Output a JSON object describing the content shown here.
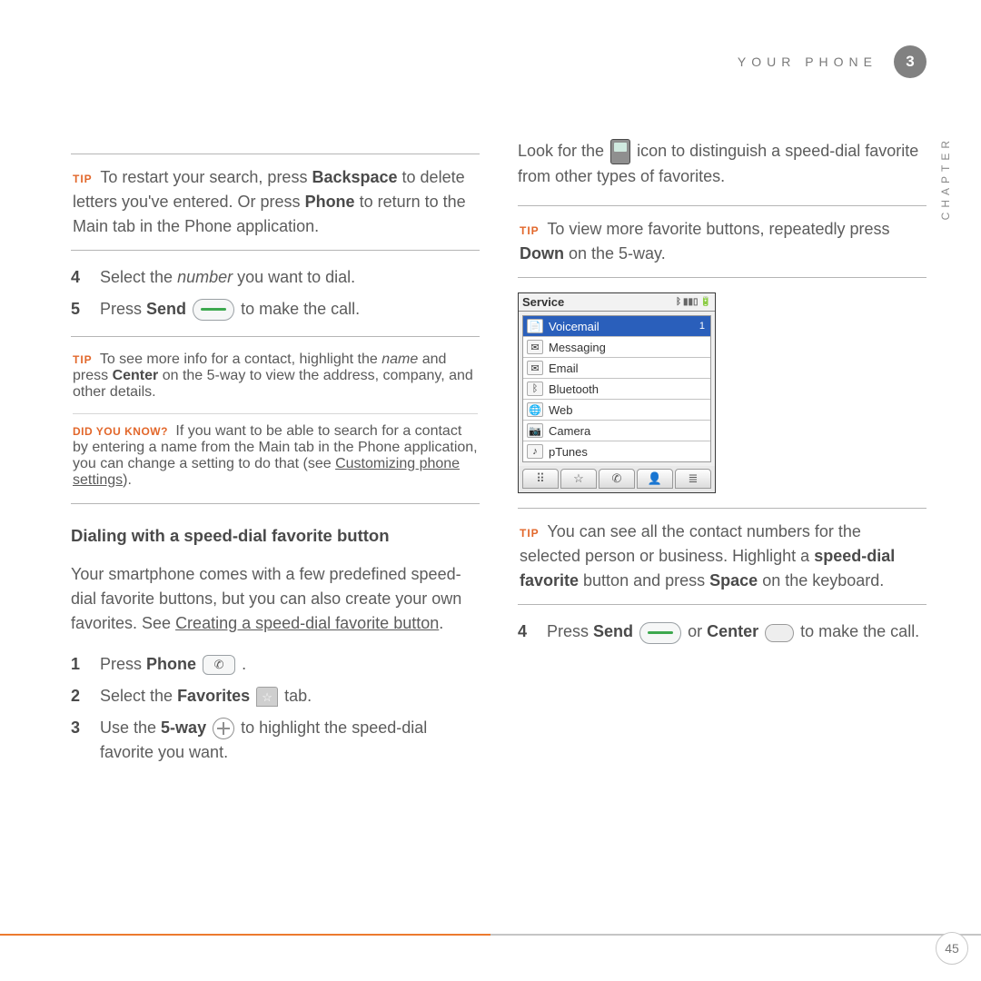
{
  "header": {
    "section": "YOUR PHONE",
    "chapter_num": "3",
    "side_label": "CHAPTER"
  },
  "left": {
    "tip1": {
      "label": "TIP",
      "text_a": "To restart your search, press ",
      "bold_a": "Backspace",
      "text_b": " to delete letters you've entered. Or press ",
      "bold_b": "Phone",
      "text_c": " to return to the Main tab in the Phone application."
    },
    "step4": {
      "num": "4",
      "a": "Select the ",
      "italic": "number",
      "b": " you want to dial."
    },
    "step5": {
      "num": "5",
      "a": "Press ",
      "bold": "Send",
      "b": " to make the call."
    },
    "callout1": {
      "tip_label": "TIP",
      "tip_a": "To see more info for a contact, highlight the ",
      "tip_italic": "name",
      "tip_b": " and press ",
      "tip_bold": "Center",
      "tip_c": " on the 5-way to view the address, company, and other details.",
      "dyk_label": "DID YOU KNOW?",
      "dyk_a": "If you want to be able to search for a contact by entering a name from the Main tab in the Phone application, you can change a setting to do that (see ",
      "dyk_link": "Customizing phone settings",
      "dyk_b": ")."
    },
    "subhead": "Dialing with a speed-dial favorite button",
    "para_a": "Your smartphone comes with a few predefined speed-dial favorite buttons, but you can also create your own favorites. See ",
    "para_link": "Creating a speed-dial favorite button",
    "para_b": ".",
    "steps2": {
      "s1": {
        "num": "1",
        "a": "Press ",
        "bold": "Phone",
        "b": "."
      },
      "s2": {
        "num": "2",
        "a": "Select the ",
        "bold": "Favorites",
        "b": " tab."
      },
      "s3": {
        "num": "3",
        "a": "Use the ",
        "bold": "5-way",
        "b": " to highlight the speed-dial favorite you want."
      }
    }
  },
  "right": {
    "para1_a": "Look for the ",
    "para1_b": " icon to distinguish a speed-dial favorite from other types of favorites.",
    "tip2": {
      "label": "TIP",
      "a": "To view more favorite buttons, repeatedly press ",
      "bold": "Down",
      "b": " on the 5-way."
    },
    "phone": {
      "title": "Service",
      "rows": [
        {
          "label": "Voicemail",
          "badge": "1",
          "selected": true,
          "icon": "📄"
        },
        {
          "label": "Messaging",
          "icon": "✉"
        },
        {
          "label": "Email",
          "icon": "✉"
        },
        {
          "label": "Bluetooth",
          "icon": "ᛒ"
        },
        {
          "label": "Web",
          "icon": "🌐"
        },
        {
          "label": "Camera",
          "icon": "📷"
        },
        {
          "label": "pTunes",
          "icon": "♪"
        }
      ],
      "tabs": [
        "⠿",
        "☆",
        "✆",
        "👤",
        "≣"
      ]
    },
    "tip3": {
      "label": "TIP",
      "a": "You can see all the contact numbers for the selected person or business. Highlight a ",
      "bold1": "speed-dial favorite",
      "b": " button and press ",
      "bold2": "Space",
      "c": " on the keyboard."
    },
    "step4": {
      "num": "4",
      "a": "Press ",
      "bold1": "Send",
      "mid": " or ",
      "bold2": "Center",
      "b": " to make the call."
    }
  },
  "footer": {
    "page_num": "45"
  }
}
